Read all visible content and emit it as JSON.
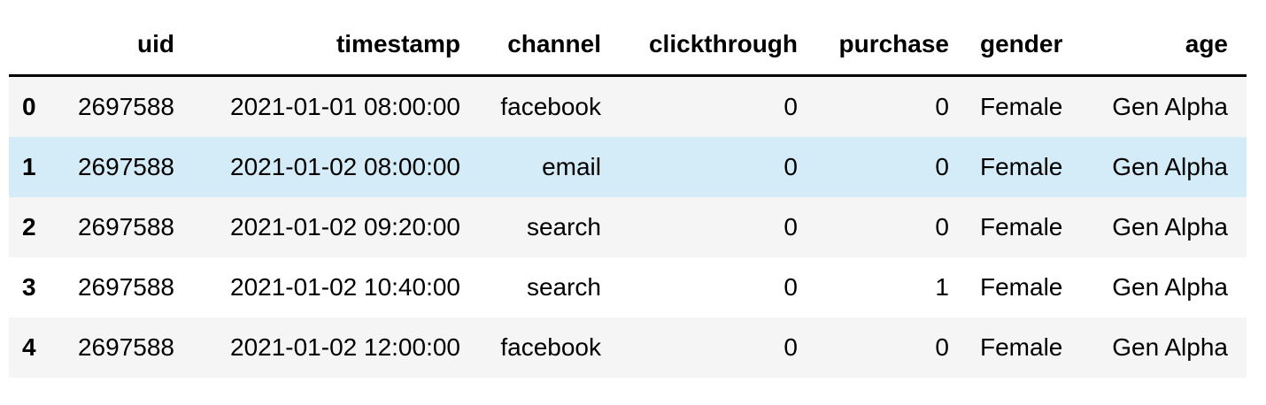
{
  "table": {
    "columns": [
      "",
      "uid",
      "timestamp",
      "channel",
      "clickthrough",
      "purchase",
      "gender",
      "age"
    ],
    "rows": [
      {
        "index": "0",
        "uid": "2697588",
        "timestamp": "2021-01-01 08:00:00",
        "channel": "facebook",
        "clickthrough": "0",
        "purchase": "0",
        "gender": "Female",
        "age": "Gen Alpha"
      },
      {
        "index": "1",
        "uid": "2697588",
        "timestamp": "2021-01-02 08:00:00",
        "channel": "email",
        "clickthrough": "0",
        "purchase": "0",
        "gender": "Female",
        "age": "Gen Alpha"
      },
      {
        "index": "2",
        "uid": "2697588",
        "timestamp": "2021-01-02 09:20:00",
        "channel": "search",
        "clickthrough": "0",
        "purchase": "0",
        "gender": "Female",
        "age": "Gen Alpha"
      },
      {
        "index": "3",
        "uid": "2697588",
        "timestamp": "2021-01-02 10:40:00",
        "channel": "search",
        "clickthrough": "0",
        "purchase": "1",
        "gender": "Female",
        "age": "Gen Alpha"
      },
      {
        "index": "4",
        "uid": "2697588",
        "timestamp": "2021-01-02 12:00:00",
        "channel": "facebook",
        "clickthrough": "0",
        "purchase": "0",
        "gender": "Female",
        "age": "Gen Alpha"
      }
    ],
    "highlighted_row": 1,
    "colors": {
      "row_striped": "#f5f5f5",
      "row_hover": "#d4ebf8",
      "header_rule": "#000000"
    }
  }
}
